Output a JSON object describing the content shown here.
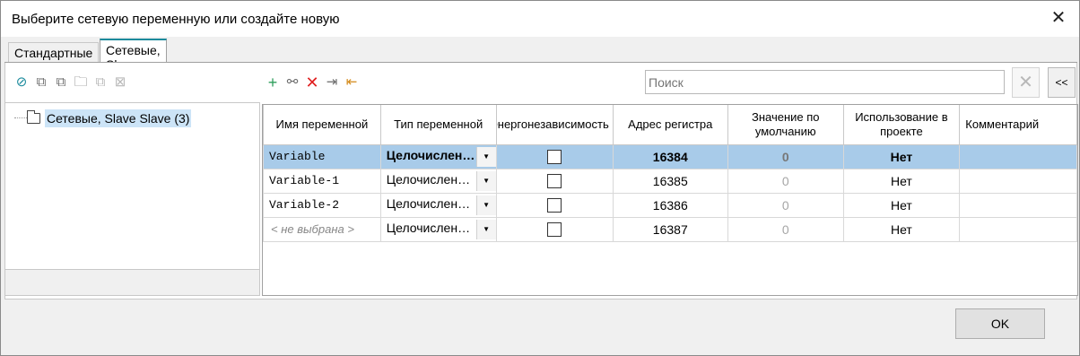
{
  "window": {
    "title": "Выберите сетевую переменную или создайте новую",
    "close_icon": "close-icon"
  },
  "tabs": [
    {
      "label": "Стандартные"
    },
    {
      "label": "Сетевые, Slave"
    }
  ],
  "toolbar_left": {
    "icons": [
      "hide-icon",
      "copy-icon",
      "duplicate-icon",
      "add-folder-icon",
      "copy-folder-icon",
      "delete-folder-icon"
    ]
  },
  "toolbar_grid": {
    "icons": [
      "add-icon",
      "add-linked-icon",
      "delete-icon",
      "export-icon",
      "import-icon"
    ]
  },
  "search": {
    "placeholder": "Поиск",
    "clear": "✕",
    "collapse": "<<"
  },
  "tree": {
    "item_label": "Сетевые, Slave Slave (3)"
  },
  "grid": {
    "columns": [
      "Имя переменной",
      "Тип переменной",
      "Энергонезависимость",
      "Адрес регистра",
      "Значение по умолчанию",
      "Использование в проекте",
      "Комментарий"
    ],
    "rows": [
      {
        "name": "Variable",
        "type": "Целочисленный",
        "retain": false,
        "address": "16384",
        "default": "0",
        "usage": "Нет",
        "comment": "",
        "selected": true
      },
      {
        "name": "Variable-1",
        "type": "Целочисленный",
        "retain": false,
        "address": "16385",
        "default": "0",
        "usage": "Нет",
        "comment": ""
      },
      {
        "name": "Variable-2",
        "type": "Целочисленный",
        "retain": false,
        "address": "16386",
        "default": "0",
        "usage": "Нет",
        "comment": ""
      },
      {
        "name": "< не выбрана >",
        "type": "Целочисленный",
        "retain": false,
        "address": "16387",
        "default": "0",
        "usage": "Нет",
        "comment": ""
      }
    ]
  },
  "footer": {
    "ok_label": "OK"
  },
  "colors": {
    "selection": "#a8cbe9",
    "tab_accent": "#1a8a9c",
    "delete_red": "#e02020",
    "add_green": "#2e9e5c"
  }
}
